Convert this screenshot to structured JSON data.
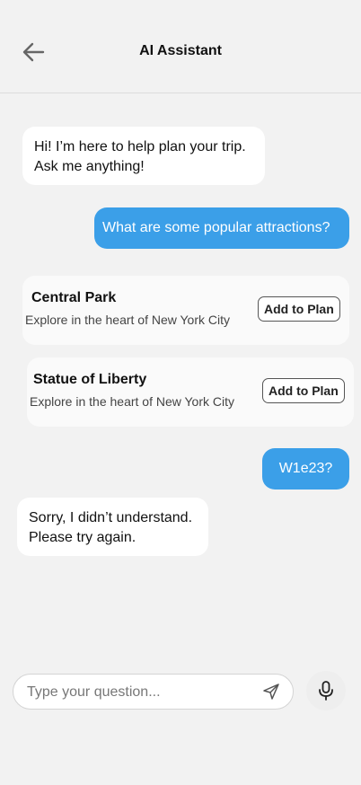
{
  "header": {
    "title": "AI Assistant",
    "back_icon": "arrow-left-icon"
  },
  "messages": [
    {
      "role": "assistant",
      "text": "Hi! I’m here to help plan your trip.\nAsk me anything!"
    },
    {
      "role": "user",
      "text": "What are some popular attractions?"
    },
    {
      "role": "user",
      "text": "W1e23?"
    },
    {
      "role": "assistant",
      "text": "Sorry, I didn’t understand.\nPlease try again."
    }
  ],
  "attractions": [
    {
      "name": "Central Park",
      "description": "Explore in the heart of New York City",
      "button_label": "Add to Plan"
    },
    {
      "name": "Statue of Liberty",
      "description": "Explore in the heart of New York City",
      "button_label": "Add to Plan"
    }
  ],
  "composer": {
    "placeholder": "Type your question...",
    "value": "",
    "send_icon": "send-icon",
    "mic_icon": "microphone-icon"
  },
  "colors": {
    "user_bubble": "#3b9fe8",
    "bot_bubble": "#ffffff",
    "background": "#f2f2f2"
  }
}
